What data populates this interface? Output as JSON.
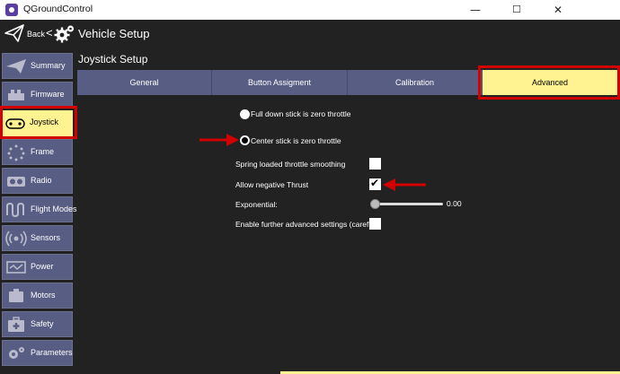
{
  "window": {
    "title": "QGroundControl",
    "minimize": "—",
    "maximize": "☐",
    "close": "✕"
  },
  "toolbar": {
    "back_label": "Back",
    "separator": "<",
    "page_title": "Vehicle Setup"
  },
  "sidebar": {
    "items": [
      {
        "label": "Summary",
        "icon": "airplane-icon",
        "active": false
      },
      {
        "label": "Firmware",
        "icon": "chip-icon",
        "active": false
      },
      {
        "label": "Joystick",
        "icon": "joystick-icon",
        "active": true
      },
      {
        "label": "Frame",
        "icon": "frame-icon",
        "active": false
      },
      {
        "label": "Radio",
        "icon": "radio-icon",
        "active": false
      },
      {
        "label": "Flight Modes",
        "icon": "waveform-icon",
        "active": false
      },
      {
        "label": "Sensors",
        "icon": "sensor-icon",
        "active": false
      },
      {
        "label": "Power",
        "icon": "power-icon",
        "active": false
      },
      {
        "label": "Motors",
        "icon": "motor-icon",
        "active": false
      },
      {
        "label": "Safety",
        "icon": "safety-icon",
        "active": false
      },
      {
        "label": "Parameters",
        "icon": "gears-icon",
        "active": false
      }
    ]
  },
  "main": {
    "section_title": "Joystick Setup",
    "tabs": [
      {
        "label": "General",
        "active": false
      },
      {
        "label": "Button Assigment",
        "active": false
      },
      {
        "label": "Calibration",
        "active": false
      },
      {
        "label": "Advanced",
        "active": true
      }
    ],
    "throttle_options": [
      {
        "label": "Full down stick is zero throttle",
        "checked": false
      },
      {
        "label": "Center stick is zero throttle",
        "checked": true
      }
    ],
    "settings": {
      "spring_loaded": {
        "label": "Spring loaded throttle smoothing",
        "checked": false
      },
      "negative_thrust": {
        "label": "Allow negative Thrust",
        "checked": true
      },
      "exponential": {
        "label": "Exponential:",
        "value": "0.00",
        "level": 0
      },
      "advanced": {
        "label": "Enable further advanced settings (careful!)",
        "checked": false
      }
    }
  },
  "colors": {
    "background": "#222222",
    "nav_button": "#585d83",
    "active_yellow": "#fff291",
    "annotation_red": "#d30000"
  }
}
